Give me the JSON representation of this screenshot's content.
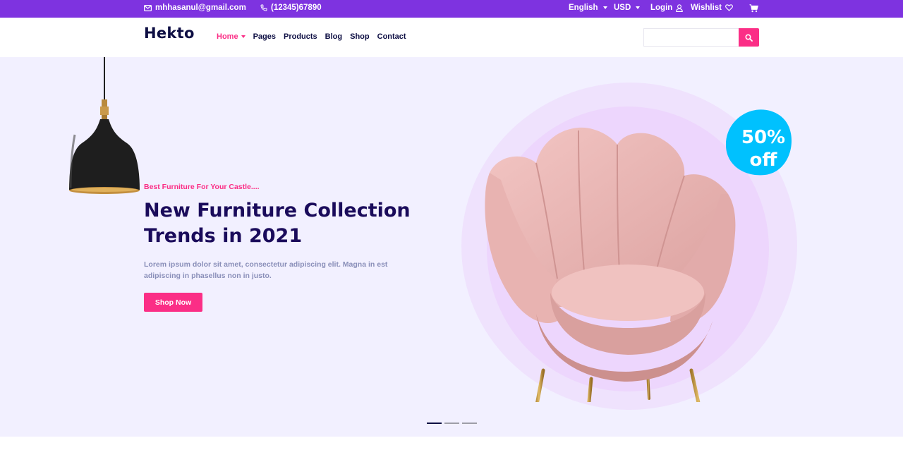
{
  "topbar": {
    "email": "mhhasanul@gmail.com",
    "phone": "(12345)67890",
    "language": "English",
    "currency": "USD",
    "login": "Login",
    "wishlist": "Wishlist",
    "icons": [
      "mail-icon",
      "phone-icon",
      "user-icon",
      "heart-icon",
      "cart-icon"
    ],
    "bg_color": "#7e33e0"
  },
  "navbar": {
    "logo": "Hekto",
    "menu": [
      {
        "label": "Home",
        "active": true
      },
      {
        "label": "Pages"
      },
      {
        "label": "Products"
      },
      {
        "label": "Blog"
      },
      {
        "label": "Shop"
      },
      {
        "label": "Contact"
      }
    ],
    "search_value": "",
    "accent_color": "#fb2e86"
  },
  "hero": {
    "eyebrow": "Best Furniture For Your Castle....",
    "headline_line1": "New Furniture Collection",
    "headline_line2": "Trends in 2021",
    "description": "Lorem ipsum dolor sit amet, consectetur adipiscing elit. Magna in est adipiscing in phasellus non in justo.",
    "cta": "Shop Now",
    "badge_line1": "50%",
    "badge_line2": "off",
    "bg_color": "#f2f0ff",
    "slides": [
      {
        "active": true
      },
      {
        "active": false
      },
      {
        "active": false
      }
    ]
  }
}
